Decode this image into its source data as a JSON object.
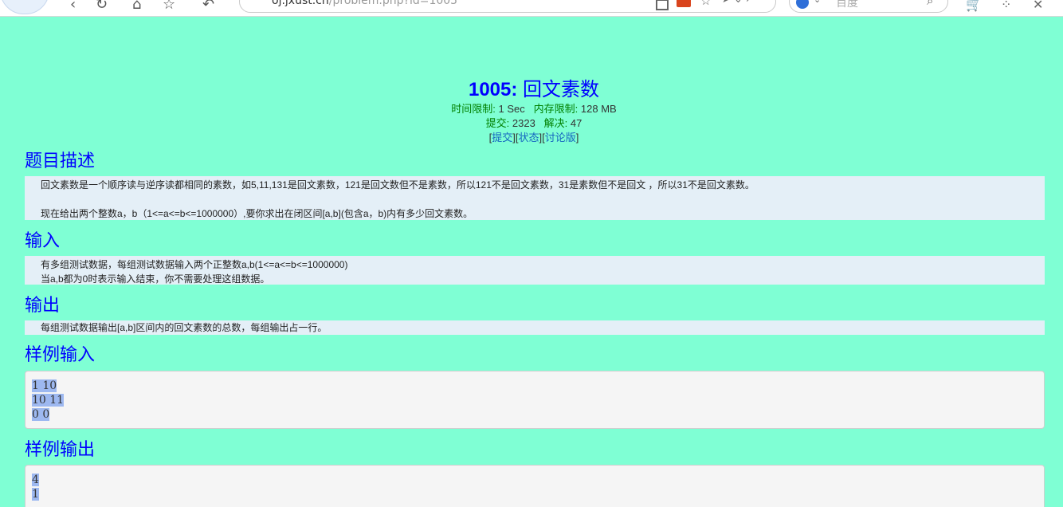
{
  "browser": {
    "url_host": "oj.jxust.cn",
    "url_path": "/problem.php?id=1005",
    "search_placeholder": "百度",
    "buttons": {
      "back": "‹",
      "refresh": "↻",
      "home": "⌂",
      "favorite": "☆",
      "undo": "↶"
    },
    "icons": [
      "qr-code-icon",
      "badge-icon",
      "star-icon",
      "forward-icon",
      "search-icon",
      "cart-icon",
      "extensions-icon",
      "close-icon"
    ]
  },
  "problem": {
    "id_label": "1005:",
    "name": "回文素数",
    "time_limit_label": "时间限制:",
    "time_limit_value": "1 Sec",
    "memory_limit_label": "内存限制:",
    "memory_limit_value": "128 MB",
    "submit_count_label": "提交:",
    "submit_count_value": "2323",
    "solved_label": "解决:",
    "solved_value": "47",
    "links": {
      "submit": "提交",
      "status": "状态",
      "discuss": "讨论版"
    }
  },
  "sections": {
    "description": {
      "heading": "题目描述",
      "lines": [
        "回文素数是一个顺序读与逆序读都相同的素数，如5,11,131是回文素数，121是回文数但不是素数，所以121不是回文素数，31是素数但不是回文 ，所以31不是回文素数。",
        "",
        "现在给出两个整数a，b（1<=a<=b<=1000000）,要你求出在闭区间[a,b](包含a，b)内有多少回文素数。"
      ]
    },
    "input": {
      "heading": "输入",
      "lines": [
        "有多组测试数据，每组测试数据输入两个正整数a,b(1<=a<=b<=1000000)",
        "当a,b都为0时表示输入结束，你不需要处理这组数据。"
      ]
    },
    "output": {
      "heading": "输出",
      "lines": [
        "每组测试数据输出[a,b]区间内的回文素数的总数，每组输出占一行。"
      ]
    },
    "sample_input": {
      "heading": "样例输入",
      "lines": [
        "1  10",
        "10  11",
        "0  0"
      ]
    },
    "sample_output": {
      "heading": "样例输出",
      "lines": [
        "4",
        "1"
      ]
    }
  }
}
